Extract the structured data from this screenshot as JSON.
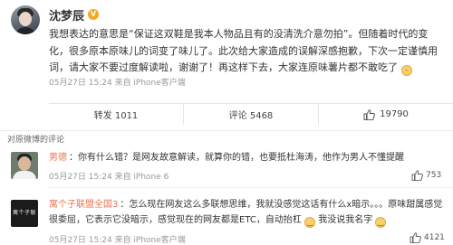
{
  "post": {
    "author": "沈梦辰",
    "verified_badge": "V",
    "text": "我想表达的意思是“保证这双鞋是我本人物品且有的没清洗介意勿拍”。但随着时代的变化，很多原本原味儿的词变了味儿了。此次给大家造成的误解深感抱歉，下次一定谨慎用词，请大家不要过度解读啦，谢谢了！再这样下去，大家连原味薯片都不敢吃了",
    "emoji": "😓",
    "time": "05月27日 15:24 来自 iPhone客户端"
  },
  "actions": {
    "share": "转发 1011",
    "comment": "评论 5468",
    "like_count": "19790"
  },
  "comments_header": "对原微博的评论",
  "comments": [
    {
      "user": "男德",
      "content": "：你有什么错？是网友故意解读，就算你的错，也要抵杜海涛，他作为男人不懂提醒",
      "time": "05月27日 15:24 来自 iPhone 6",
      "likes": "753"
    },
    {
      "user": "寓个子联盟全国3",
      "avatar_text": "寓个子联盟",
      "content": "：怎么现在网友这么多联想思维，我就没感觉这话有什么x暗示。。。原味甜属感觉很委屈，它表示它没暗示，感觉现在的网友都是ETC，自动抬杠",
      "emoji_1": "😄",
      "middle": "我没说我名字",
      "emoji_2": "😄",
      "time": "05月27日 15:24 来自 iPhone客户端",
      "likes": "4121"
    }
  ],
  "icons": {
    "thumb": "thumbs-up-icon",
    "phone": "phone-icon"
  },
  "colors": {
    "username": "#eb7350",
    "meta": "#999999",
    "verified": "#f4a722"
  }
}
